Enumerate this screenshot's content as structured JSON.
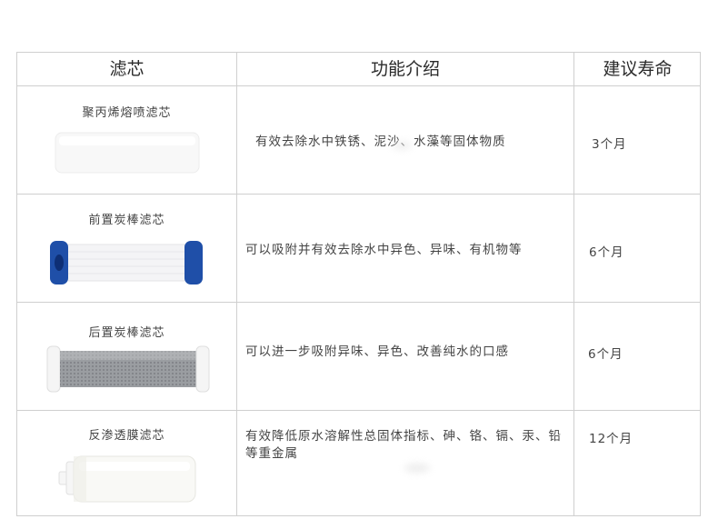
{
  "table": {
    "headers": {
      "filter": "滤芯",
      "function": "功能介绍",
      "lifespan": "建议寿命"
    },
    "rows": [
      {
        "name": "聚丙烯熔喷滤芯",
        "function": "有效去除水中铁锈、泥沙、水藻等固体物质",
        "lifespan": "3个月",
        "image": "pp-cotton-cartridge"
      },
      {
        "name": "前置炭棒滤芯",
        "function": "可以吸附并有效去除水中异色、异味、有机物等",
        "lifespan": "6个月",
        "image": "pre-carbon-block-cartridge"
      },
      {
        "name": "后置炭棒滤芯",
        "function": "可以进一步吸附异味、异色、改善纯水的口感",
        "lifespan": "6个月",
        "image": "post-carbon-block-cartridge"
      },
      {
        "name": "反渗透膜滤芯",
        "function": "有效降低原水溶解性总固体指标、砷、铬、镉、汞、铅等重金属",
        "lifespan": "12个月",
        "image": "ro-membrane-cartridge"
      }
    ]
  },
  "colors": {
    "border": "#cfcfcf",
    "cap_blue": "#1f4fa8",
    "cartridge_white": "#f7f7f7",
    "carbon_grey": "#8f9296"
  }
}
